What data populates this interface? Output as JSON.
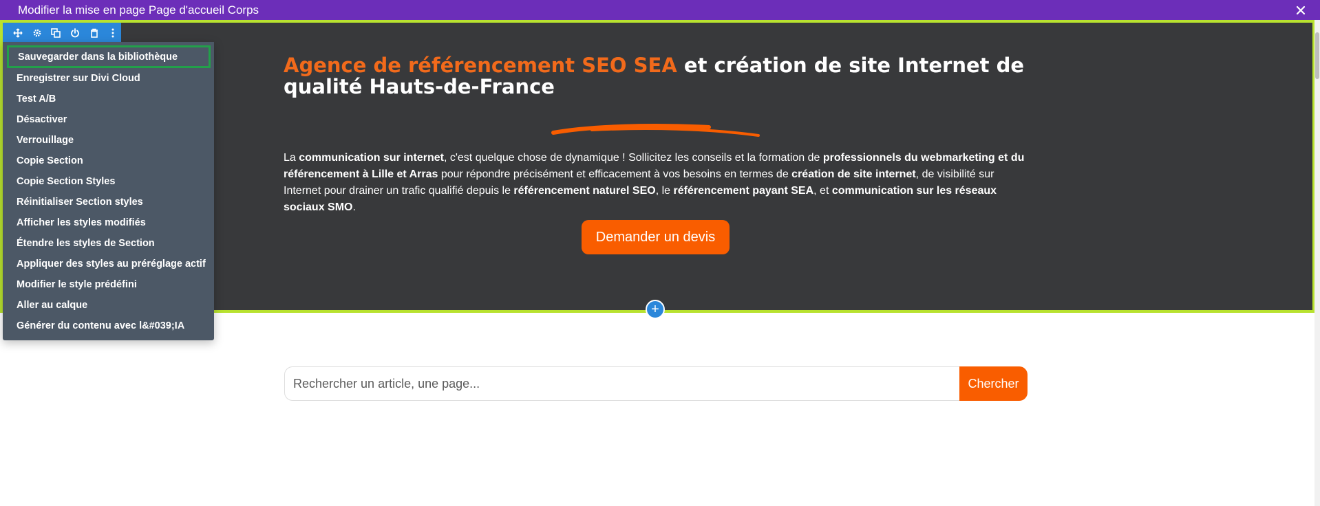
{
  "topbar": {
    "title": "Modifier la mise en page Page d'accueil Corps",
    "close_icon": "close-icon"
  },
  "section_toolbar": {
    "icons": [
      "move-icon",
      "gear-icon",
      "duplicate-icon",
      "power-icon",
      "trash-icon",
      "more-vertical-icon"
    ]
  },
  "context_menu": {
    "items": [
      "Sauvegarder dans la bibliothèque",
      "Enregistrer sur Divi Cloud",
      "Test A/B",
      "Désactiver",
      "Verrouillage",
      "Copie Section",
      "Copie Section Styles",
      "Réinitialiser Section styles",
      "Afficher les styles modifiés",
      "Étendre les styles de Section",
      "Appliquer des styles au préréglage actif",
      "Modifier le style prédéfini",
      "Aller au calque",
      "Générer du contenu avec l&#039;IA"
    ]
  },
  "hero": {
    "title_accent": "Agence de référencement SEO SEA",
    "title_rest": " et création de site Internet de qualité Hauts-de-France",
    "text": {
      "p1": "La ",
      "b1": "communication sur internet",
      "p2": ", c'est quelque chose de dynamique ! Sollicitez les conseils et la formation de ",
      "b2": "professionnels du webmarketing et du référencement à Lille et Arras",
      "p3": " pour répondre précisément et efficacement à vos besoins en termes de ",
      "b3": "création de site internet",
      "p4": ", de visibilité sur Internet pour drainer un trafic qualifié depuis le ",
      "b4": "référencement naturel SEO",
      "p5": ", le ",
      "b5": "référencement payant SEA",
      "p6": ", et ",
      "b6": "communication sur les réseaux sociaux SMO",
      "p7": "."
    },
    "cta_label": "Demander un devis"
  },
  "add_button_symbol": "+",
  "search": {
    "placeholder": "Rechercher un article, une page...",
    "button_label": "Chercher"
  },
  "colors": {
    "topbar": "#6c2eb9",
    "section_bg": "#38393b",
    "section_outline": "#b8e22f",
    "accent_orange": "#f95d00",
    "toolbar_blue": "#2b87da",
    "menu_bg": "#4c5866",
    "menu_active_border": "#22a04a"
  }
}
